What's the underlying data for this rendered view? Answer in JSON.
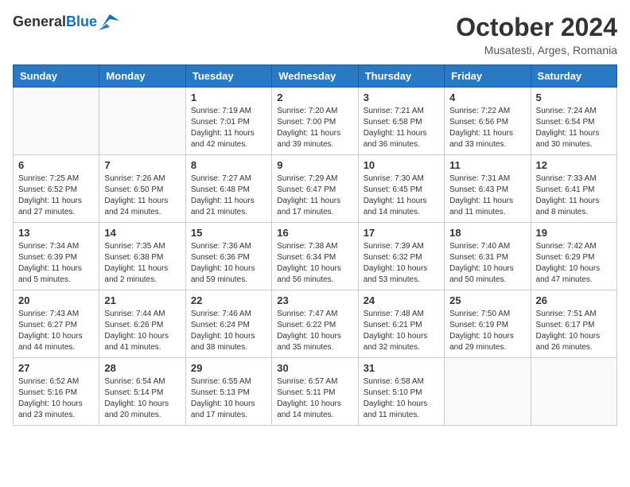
{
  "header": {
    "logo_general": "General",
    "logo_blue": "Blue",
    "month_title": "October 2024",
    "subtitle": "Musatesti, Arges, Romania"
  },
  "weekdays": [
    "Sunday",
    "Monday",
    "Tuesday",
    "Wednesday",
    "Thursday",
    "Friday",
    "Saturday"
  ],
  "weeks": [
    [
      {
        "day": "",
        "info": ""
      },
      {
        "day": "",
        "info": ""
      },
      {
        "day": "1",
        "info": "Sunrise: 7:19 AM\nSunset: 7:01 PM\nDaylight: 11 hours and 42 minutes."
      },
      {
        "day": "2",
        "info": "Sunrise: 7:20 AM\nSunset: 7:00 PM\nDaylight: 11 hours and 39 minutes."
      },
      {
        "day": "3",
        "info": "Sunrise: 7:21 AM\nSunset: 6:58 PM\nDaylight: 11 hours and 36 minutes."
      },
      {
        "day": "4",
        "info": "Sunrise: 7:22 AM\nSunset: 6:56 PM\nDaylight: 11 hours and 33 minutes."
      },
      {
        "day": "5",
        "info": "Sunrise: 7:24 AM\nSunset: 6:54 PM\nDaylight: 11 hours and 30 minutes."
      }
    ],
    [
      {
        "day": "6",
        "info": "Sunrise: 7:25 AM\nSunset: 6:52 PM\nDaylight: 11 hours and 27 minutes."
      },
      {
        "day": "7",
        "info": "Sunrise: 7:26 AM\nSunset: 6:50 PM\nDaylight: 11 hours and 24 minutes."
      },
      {
        "day": "8",
        "info": "Sunrise: 7:27 AM\nSunset: 6:48 PM\nDaylight: 11 hours and 21 minutes."
      },
      {
        "day": "9",
        "info": "Sunrise: 7:29 AM\nSunset: 6:47 PM\nDaylight: 11 hours and 17 minutes."
      },
      {
        "day": "10",
        "info": "Sunrise: 7:30 AM\nSunset: 6:45 PM\nDaylight: 11 hours and 14 minutes."
      },
      {
        "day": "11",
        "info": "Sunrise: 7:31 AM\nSunset: 6:43 PM\nDaylight: 11 hours and 11 minutes."
      },
      {
        "day": "12",
        "info": "Sunrise: 7:33 AM\nSunset: 6:41 PM\nDaylight: 11 hours and 8 minutes."
      }
    ],
    [
      {
        "day": "13",
        "info": "Sunrise: 7:34 AM\nSunset: 6:39 PM\nDaylight: 11 hours and 5 minutes."
      },
      {
        "day": "14",
        "info": "Sunrise: 7:35 AM\nSunset: 6:38 PM\nDaylight: 11 hours and 2 minutes."
      },
      {
        "day": "15",
        "info": "Sunrise: 7:36 AM\nSunset: 6:36 PM\nDaylight: 10 hours and 59 minutes."
      },
      {
        "day": "16",
        "info": "Sunrise: 7:38 AM\nSunset: 6:34 PM\nDaylight: 10 hours and 56 minutes."
      },
      {
        "day": "17",
        "info": "Sunrise: 7:39 AM\nSunset: 6:32 PM\nDaylight: 10 hours and 53 minutes."
      },
      {
        "day": "18",
        "info": "Sunrise: 7:40 AM\nSunset: 6:31 PM\nDaylight: 10 hours and 50 minutes."
      },
      {
        "day": "19",
        "info": "Sunrise: 7:42 AM\nSunset: 6:29 PM\nDaylight: 10 hours and 47 minutes."
      }
    ],
    [
      {
        "day": "20",
        "info": "Sunrise: 7:43 AM\nSunset: 6:27 PM\nDaylight: 10 hours and 44 minutes."
      },
      {
        "day": "21",
        "info": "Sunrise: 7:44 AM\nSunset: 6:26 PM\nDaylight: 10 hours and 41 minutes."
      },
      {
        "day": "22",
        "info": "Sunrise: 7:46 AM\nSunset: 6:24 PM\nDaylight: 10 hours and 38 minutes."
      },
      {
        "day": "23",
        "info": "Sunrise: 7:47 AM\nSunset: 6:22 PM\nDaylight: 10 hours and 35 minutes."
      },
      {
        "day": "24",
        "info": "Sunrise: 7:48 AM\nSunset: 6:21 PM\nDaylight: 10 hours and 32 minutes."
      },
      {
        "day": "25",
        "info": "Sunrise: 7:50 AM\nSunset: 6:19 PM\nDaylight: 10 hours and 29 minutes."
      },
      {
        "day": "26",
        "info": "Sunrise: 7:51 AM\nSunset: 6:17 PM\nDaylight: 10 hours and 26 minutes."
      }
    ],
    [
      {
        "day": "27",
        "info": "Sunrise: 6:52 AM\nSunset: 5:16 PM\nDaylight: 10 hours and 23 minutes."
      },
      {
        "day": "28",
        "info": "Sunrise: 6:54 AM\nSunset: 5:14 PM\nDaylight: 10 hours and 20 minutes."
      },
      {
        "day": "29",
        "info": "Sunrise: 6:55 AM\nSunset: 5:13 PM\nDaylight: 10 hours and 17 minutes."
      },
      {
        "day": "30",
        "info": "Sunrise: 6:57 AM\nSunset: 5:11 PM\nDaylight: 10 hours and 14 minutes."
      },
      {
        "day": "31",
        "info": "Sunrise: 6:58 AM\nSunset: 5:10 PM\nDaylight: 10 hours and 11 minutes."
      },
      {
        "day": "",
        "info": ""
      },
      {
        "day": "",
        "info": ""
      }
    ]
  ]
}
